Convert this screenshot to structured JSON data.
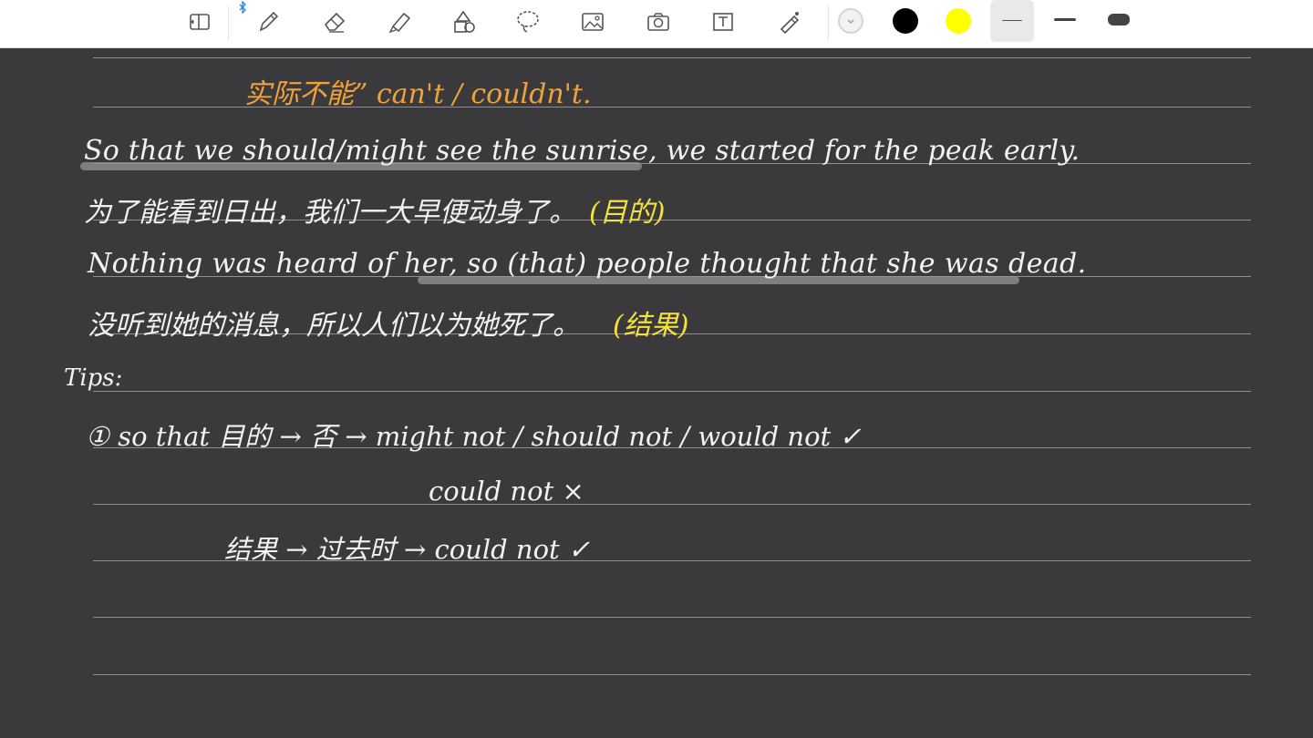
{
  "toolbar": {
    "tools": [
      "page-layout-icon",
      "bluetooth-icon",
      "pen-icon",
      "eraser-icon",
      "highlighter-icon",
      "shapes-icon",
      "lasso-icon",
      "image-icon",
      "camera-icon",
      "text-box-icon",
      "laser-pointer-icon"
    ],
    "colors": [
      "#f2f2f2",
      "#000000",
      "#ffff00"
    ],
    "stroke_widths": [
      "thin",
      "medium",
      "thick"
    ]
  },
  "notes": {
    "line_orange_top": "实际不能” can't / couldn't.",
    "line1": "So that we should/might see the sunrise, we started for the peak early.",
    "line2_cn": "为了能看到日出，我们一大早便动身了。",
    "line2_tag": "(目的)",
    "line3": "Nothing was heard of her, so (that) people thought that she was dead.",
    "line4_cn": "没听到她的消息，所以人们以为她死了。",
    "line4_tag": "(结果)",
    "tips": "Tips:",
    "tip1": "① so that 目的 → 否 → might not / should not / would not ✓",
    "tip1b": "could not ×",
    "tip2": "结果 → 过去时 → could not ✓"
  }
}
